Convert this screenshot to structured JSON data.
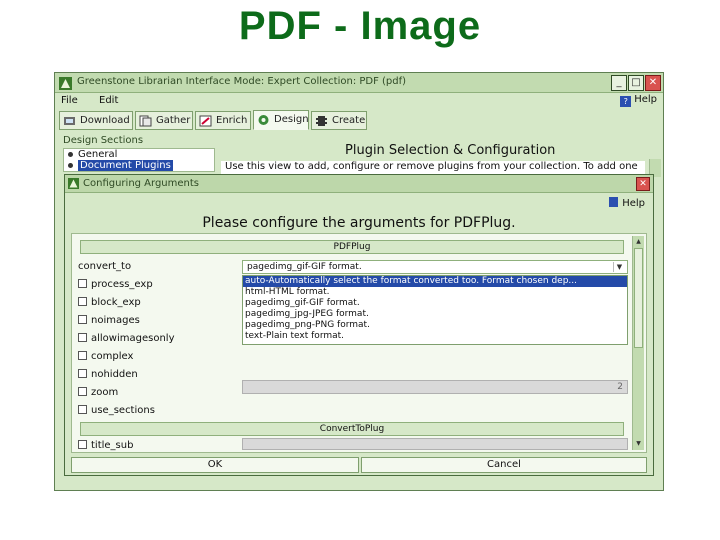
{
  "slide": {
    "title": "PDF - Image"
  },
  "window": {
    "title": "Greenstone Librarian Interface  Mode: Expert  Collection: PDF (pdf)",
    "controls": {
      "minimize": "_",
      "maximize": "□",
      "close": "✕"
    }
  },
  "menu": {
    "file": "File",
    "edit": "Edit",
    "help": "Help"
  },
  "tabs": [
    {
      "label": "Download",
      "icon": "download-icon"
    },
    {
      "label": "Gather",
      "icon": "gather-icon"
    },
    {
      "label": "Enrich",
      "icon": "enrich-icon"
    },
    {
      "label": "Design",
      "icon": "design-icon",
      "active": true
    },
    {
      "label": "Create",
      "icon": "create-icon"
    }
  ],
  "design_sections": {
    "header": "Design Sections",
    "items": [
      {
        "label": "General"
      },
      {
        "label": "Document Plugins",
        "selected": true
      }
    ]
  },
  "plugin_panel": {
    "title": "Plugin Selection & Configuration",
    "description": "Use this view to add, configure or remove plugins from your collection. To add one"
  },
  "dialog": {
    "title": "Configuring Arguments",
    "close": "✕",
    "help": "Help",
    "heading": "Please configure the arguments for PDFPlug.",
    "group1": "PDFPlug",
    "convert_to": {
      "label": "convert_to",
      "value": "pagedimg_gif-GIF format.",
      "options": [
        "auto-Automatically select the format converted too.  Format chosen dep...",
        "html-HTML format.",
        "pagedimg_gif-GIF format.",
        "pagedimg_jpg-JPEG format.",
        "pagedimg_png-PNG format.",
        "text-Plain text format."
      ]
    },
    "checkboxes": [
      "process_exp",
      "block_exp",
      "noimages",
      "allowimagesonly",
      "complex",
      "nohidden",
      "zoom",
      "use_sections"
    ],
    "zoom_value": "2",
    "group2": "ConvertToPlug",
    "title_sub": "title_sub",
    "ok": "OK",
    "cancel": "Cancel"
  },
  "colors": {
    "slide_title": "#0d6b1a",
    "window_bg": "#d6e8c8",
    "selection": "#244aa8",
    "close_button": "#d9534f"
  }
}
